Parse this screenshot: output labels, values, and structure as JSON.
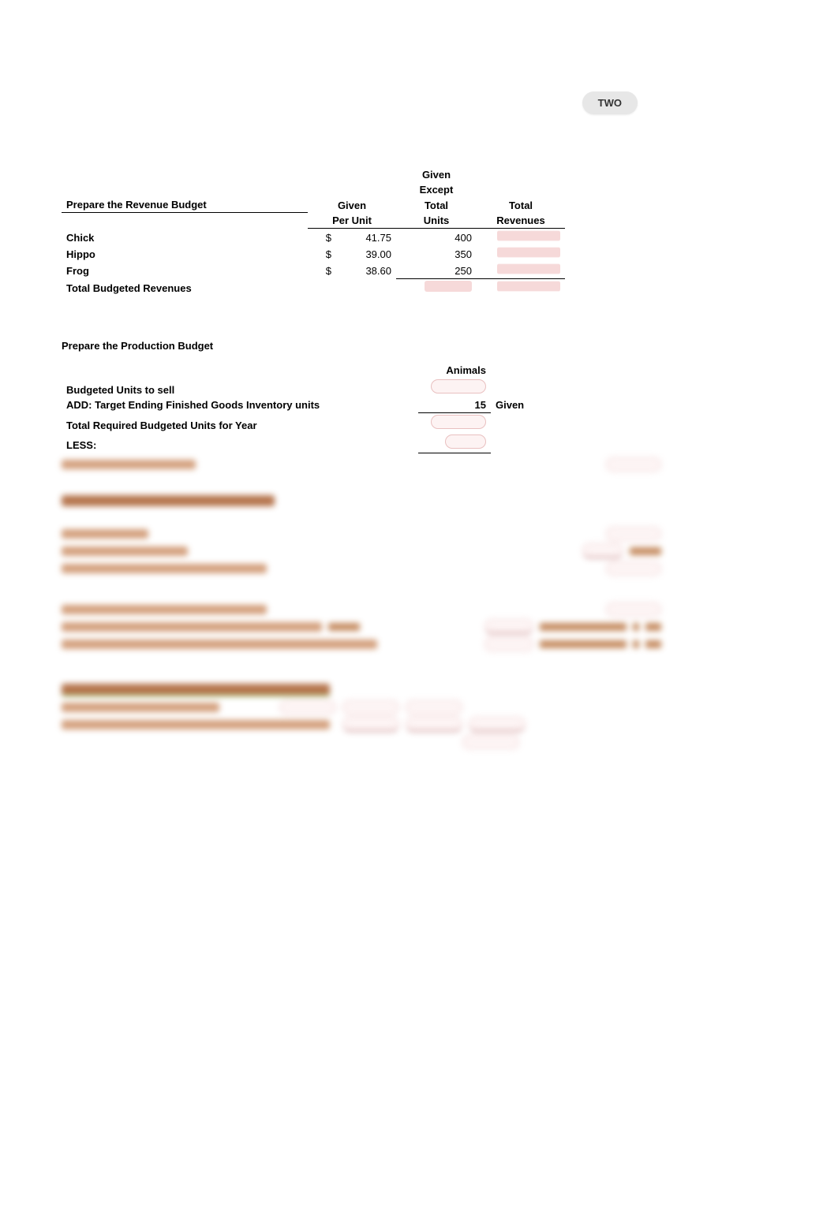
{
  "badge": {
    "label": "TWO"
  },
  "revenue": {
    "header": "Prepare the Revenue Budget",
    "col_headers": {
      "given_except": "Given Except",
      "given_per_unit": "Given Per Unit",
      "total_units": "Total Units",
      "total_revenues": "Total Revenues"
    },
    "rows": [
      {
        "label": "Chick",
        "currency": "$",
        "per_unit": "41.75",
        "units": "400"
      },
      {
        "label": "Hippo",
        "currency": "$",
        "per_unit": "39.00",
        "units": "350"
      },
      {
        "label": "Frog",
        "currency": "$",
        "per_unit": "38.60",
        "units": "250"
      }
    ],
    "total_label": "Total Budgeted Revenues"
  },
  "production": {
    "header": "Prepare the Production Budget",
    "animals_header": "Animals",
    "rows": {
      "budgeted_units": "Budgeted Units to sell",
      "add_target": "ADD: Target Ending Finished Goods Inventory units",
      "add_target_value": "15",
      "add_target_note": "Given",
      "total_required": "Total Required Budgeted Units for Year",
      "less": "LESS:"
    }
  }
}
